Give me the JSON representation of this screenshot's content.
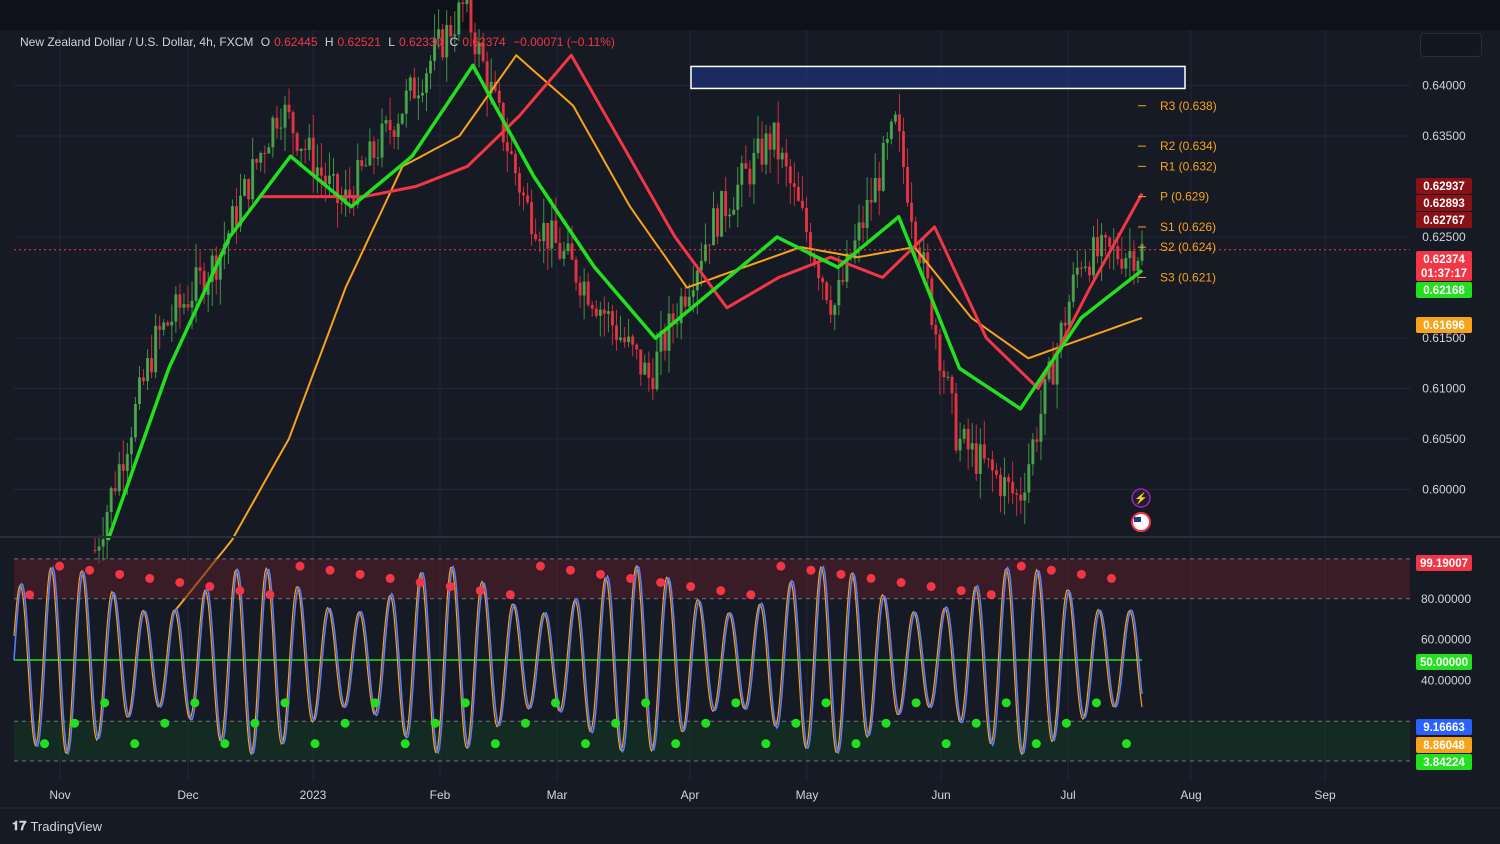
{
  "legend": {
    "title": "New Zealand Dollar / U.S. Dollar, 4h, FXCM",
    "o_key": "O",
    "o_val": "0.62445",
    "h_key": "H",
    "h_val": "0.62521",
    "l_key": "L",
    "l_val": "0.62330",
    "c_key": "C",
    "c_val": "0.62374",
    "change": "−0.00071 (−0.11%)"
  },
  "footer": {
    "brand": "TradingView"
  },
  "colors": {
    "background": "#161a25",
    "grid": "#232736",
    "up": "#4caf50",
    "down": "#f23645",
    "ema_green": "#22e01f",
    "ema_red": "#f23645",
    "ema_orange": "#f7a21b",
    "stoch_k": "#5b7cf7",
    "stoch_d": "#f7a21b",
    "pivot": "#f7a21b",
    "zone": "#2962ff"
  },
  "chart_data": [
    {
      "type": "line",
      "title": "New Zealand Dollar / U.S. Dollar, 4h, FXCM",
      "x_labels": [
        "Nov",
        "Dec",
        "2023",
        "Feb",
        "Mar",
        "Apr",
        "May",
        "Jun",
        "Jul",
        "Aug",
        "Sep"
      ],
      "y_ticks": [
        "0.64000",
        "0.63500",
        "0.62500",
        "0.61500",
        "0.61000",
        "0.60500",
        "0.60000"
      ],
      "ylim": [
        0.5955,
        0.6455
      ],
      "series": [
        {
          "role": "price",
          "x": [
            "Nov",
            "Nov",
            "Dec",
            "Dec",
            "2023",
            "2023",
            "Feb",
            "Feb",
            "Mar",
            "Mar",
            "Apr",
            "Apr",
            "May",
            "May",
            "Jun",
            "Jun",
            "Jul",
            "Jul"
          ],
          "values": [
            0.594,
            0.615,
            0.623,
            0.638,
            0.628,
            0.638,
            0.648,
            0.628,
            0.62,
            0.611,
            0.626,
            0.635,
            0.618,
            0.636,
            0.605,
            0.599,
            0.623,
            0.6237
          ]
        },
        {
          "role": "ema-fast-green",
          "values": [
            0.595,
            0.612,
            0.625,
            0.633,
            0.628,
            0.633,
            0.642,
            0.631,
            0.622,
            0.615,
            0.62,
            0.625,
            0.622,
            0.627,
            0.612,
            0.608,
            0.617,
            0.6217
          ]
        },
        {
          "role": "ema-red",
          "values": [
            0.629,
            0.629,
            0.629,
            0.63,
            0.632,
            0.637,
            0.643,
            0.634,
            0.625,
            0.618,
            0.621,
            0.623,
            0.621,
            0.626,
            0.615,
            0.61,
            0.62,
            0.6293
          ]
        },
        {
          "role": "ema-slow-orange",
          "values": [
            0.588,
            0.595,
            0.605,
            0.62,
            0.632,
            0.635,
            0.643,
            0.638,
            0.628,
            0.62,
            0.622,
            0.624,
            0.623,
            0.624,
            0.617,
            0.613,
            0.615,
            0.617
          ]
        }
      ],
      "price_labels": [
        {
          "text": "0.62937",
          "color": "#8b1116"
        },
        {
          "text": "0.62893",
          "color": "#8b1116"
        },
        {
          "text": "0.62767",
          "color": "#8b1116"
        },
        {
          "text": "0.62374",
          "color": "#f23645"
        },
        {
          "text": "01:37:17",
          "color": "#f23645"
        },
        {
          "text": "0.62168",
          "color": "#22e01f"
        },
        {
          "text": "0.61696",
          "color": "#f7a21b"
        }
      ],
      "pivots": [
        {
          "label": "R3 (0.638)",
          "value": 0.638
        },
        {
          "label": "R2 (0.634)",
          "value": 0.634
        },
        {
          "label": "R1 (0.632)",
          "value": 0.632
        },
        {
          "label": "P (0.629)",
          "value": 0.629
        },
        {
          "label": "S1 (0.626)",
          "value": 0.626
        },
        {
          "label": "S2 (0.624)",
          "value": 0.624
        },
        {
          "label": "S3 (0.621)",
          "value": 0.621
        }
      ],
      "zone": {
        "from": "Apr",
        "to": "Jul",
        "y_low": 0.639,
        "y_high": 0.641
      }
    },
    {
      "type": "line",
      "title": "",
      "y_ticks": [
        "80.00000",
        "60.00000",
        "40.00000"
      ],
      "ylim": [
        0,
        100
      ],
      "levels": [
        80,
        50,
        20
      ],
      "series": [
        {
          "role": "stoch-k",
          "values": [
            40,
            95,
            10,
            90,
            5,
            95,
            20,
            85,
            10,
            95,
            5,
            90,
            15,
            95,
            8,
            92,
            12,
            96,
            6,
            88,
            10,
            95,
            3,
            9.16663
          ]
        },
        {
          "role": "stoch-d",
          "values": [
            35,
            90,
            15,
            85,
            10,
            90,
            25,
            80,
            15,
            90,
            10,
            85,
            20,
            90,
            12,
            88,
            15,
            92,
            10,
            85,
            15,
            90,
            8,
            8.86048
          ]
        }
      ],
      "price_labels": [
        {
          "text": "99.19007",
          "color": "#f23645"
        },
        {
          "text": "50.00000",
          "color": "#22e01f"
        },
        {
          "text": "9.16663",
          "color": "#2962ff"
        },
        {
          "text": "8.86048",
          "color": "#f7a21b"
        },
        {
          "text": "3.84224",
          "color": "#22e01f"
        }
      ]
    }
  ]
}
